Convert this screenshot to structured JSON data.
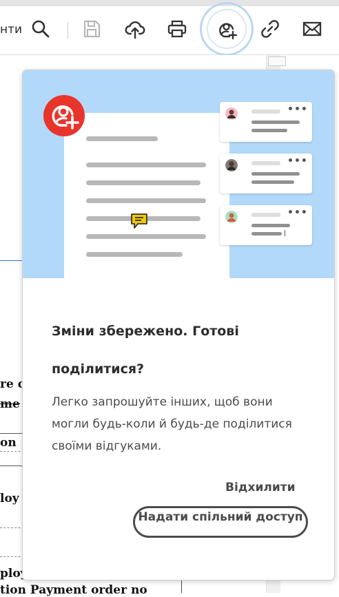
{
  "toolbar": {
    "partial_label": "нти",
    "icons": [
      "search-icon",
      "save-icon",
      "upload-cloud-icon",
      "print-icon",
      "share-user-add-icon",
      "link-icon",
      "email-icon"
    ]
  },
  "document": {
    "fragments": [
      "re c",
      "me",
      "on",
      "loy",
      "ploy",
      "tion Payment order no"
    ]
  },
  "popup": {
    "title": "Зміни збережено. Готові поділитися?",
    "body": "Легко запрошуйте інших, щоб вони могли будь-коли й будь-де поділитися своїми відгуками.",
    "dismiss_label": "Відхилити",
    "share_label": "Надати спільний доступ",
    "colors": {
      "hero_bg": "#b2d9fa",
      "badge": "#e8352c",
      "comment_icon": "#f3c800"
    }
  }
}
